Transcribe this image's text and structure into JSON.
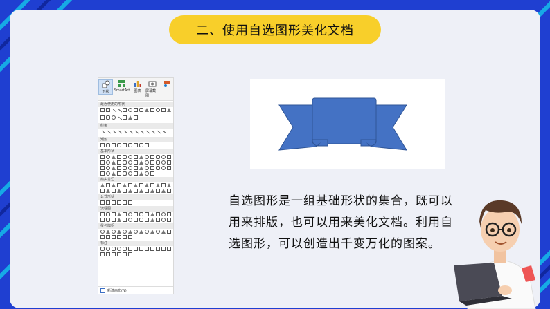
{
  "title": "二、使用自选图形美化文档",
  "description": "自选图形是一组基础形状的集合，既可以用来排版，也可以用来美化文档。利用自选图形，可以创造出千变万化的图案。",
  "colors": {
    "background": "#1f3fd1",
    "card": "#eef0f7",
    "accent": "#f8cf2a",
    "ribbon_shape": "#4472c4"
  },
  "ribbon_panel": {
    "buttons": [
      {
        "label": "形状",
        "icon": "shapes-icon",
        "selected": true
      },
      {
        "label": "SmartArt",
        "icon": "smartart-icon"
      },
      {
        "label": "图表",
        "icon": "chart-icon"
      },
      {
        "label": "屏幕截图",
        "icon": "screenshot-icon"
      },
      {
        "label": "",
        "icon": "more-icon"
      }
    ],
    "sections": [
      "最近使用的形状",
      "线条",
      "矩形",
      "基本形状",
      "箭头总汇",
      "公式形状",
      "流程图",
      "星与旗帜",
      "标注"
    ],
    "new_canvas": "新建画布(N)"
  }
}
